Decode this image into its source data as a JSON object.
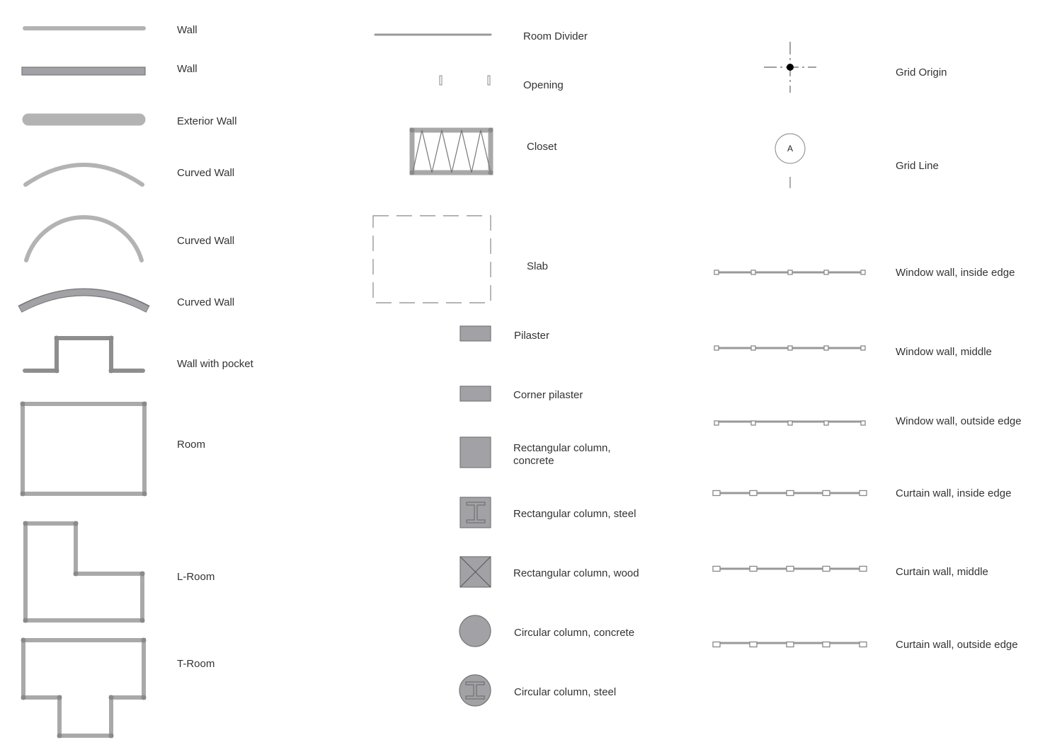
{
  "colors": {
    "wall_light": "#b3b3b3",
    "column_fill": "#a2a2a6",
    "outline": "#777777",
    "label": "#333333"
  },
  "symbols": {
    "col1": [
      {
        "label": "Wall",
        "icon": "thin-wall-icon"
      },
      {
        "label": "Wall",
        "icon": "solid-wall-icon"
      },
      {
        "label": "Exterior Wall",
        "icon": "exterior-wall-icon"
      },
      {
        "label": "Curved Wall",
        "icon": "curved-wall-shallow-icon"
      },
      {
        "label": "Curved Wall",
        "icon": "curved-wall-deep-icon"
      },
      {
        "label": "Curved Wall",
        "icon": "curved-wall-solid-icon"
      },
      {
        "label": "Wall with pocket",
        "icon": "wall-with-pocket-icon"
      },
      {
        "label": "Room",
        "icon": "room-icon"
      },
      {
        "label": "L-Room",
        "icon": "l-room-icon"
      },
      {
        "label": "T-Room",
        "icon": "t-room-icon"
      }
    ],
    "col2": [
      {
        "label": "Room Divider",
        "icon": "room-divider-icon"
      },
      {
        "label": "Opening",
        "icon": "opening-icon"
      },
      {
        "label": "Closet",
        "icon": "closet-icon"
      },
      {
        "label": "Slab",
        "icon": "slab-icon"
      },
      {
        "label": "Pilaster",
        "icon": "pilaster-icon"
      },
      {
        "label": "Corner pilaster",
        "icon": "corner-pilaster-icon"
      },
      {
        "label": "Rectangular column,",
        "label2": "concrete",
        "icon": "rect-column-concrete-icon"
      },
      {
        "label": "Rectangular column, steel",
        "icon": "rect-column-steel-icon"
      },
      {
        "label": "Rectangular column, wood",
        "icon": "rect-column-wood-icon"
      },
      {
        "label": "Circular column, concrete",
        "icon": "circular-column-concrete-icon"
      },
      {
        "label": "Circular column, steel",
        "icon": "circular-column-steel-icon"
      }
    ],
    "col3": [
      {
        "label": "Grid Origin",
        "icon": "grid-origin-icon"
      },
      {
        "label": "Grid Line",
        "icon": "grid-line-icon",
        "marker": "A"
      },
      {
        "label": "Window wall, inside edge",
        "icon": "window-wall-inside-icon"
      },
      {
        "label": "Window wall, middle",
        "icon": "window-wall-middle-icon"
      },
      {
        "label": "Window wall, outside edge",
        "icon": "window-wall-outside-icon"
      },
      {
        "label": "Curtain wall, inside edge",
        "icon": "curtain-wall-inside-icon"
      },
      {
        "label": "Curtain wall, middle",
        "icon": "curtain-wall-middle-icon"
      },
      {
        "label": "Curtain wall, outside edge",
        "icon": "curtain-wall-outside-icon"
      }
    ]
  }
}
